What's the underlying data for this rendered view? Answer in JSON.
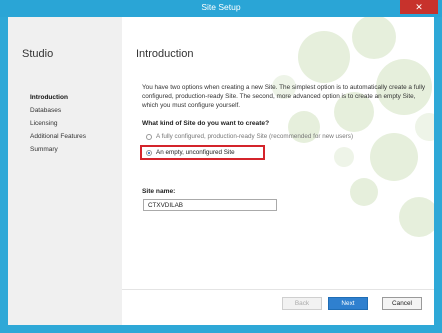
{
  "window": {
    "title": "Site Setup",
    "close_glyph": "✕"
  },
  "sidebar": {
    "title": "Studio",
    "items": [
      {
        "label": "Introduction",
        "active": true
      },
      {
        "label": "Databases"
      },
      {
        "label": "Licensing"
      },
      {
        "label": "Additional Features"
      },
      {
        "label": "Summary"
      }
    ]
  },
  "main": {
    "title": "Introduction",
    "intro": "You have two options when creating a new Site. The simplest option is to automatically create a fully configured, production-ready Site. The second, more advanced option is to create an empty Site, which you must configure yourself.",
    "question": "What kind of Site do you want to create?",
    "options": [
      {
        "label": "A fully configured, production-ready Site (recommended for new users)",
        "selected": false
      },
      {
        "label": "An empty, unconfigured Site",
        "selected": true
      }
    ],
    "site_name_label": "Site name:",
    "site_name_value": "CTXVDILAB"
  },
  "buttons": {
    "back": "Back",
    "next": "Next",
    "cancel": "Cancel"
  },
  "colors": {
    "accent": "#2ea8d7",
    "highlight": "#d4242b",
    "primary_button": "#2f80cf"
  }
}
